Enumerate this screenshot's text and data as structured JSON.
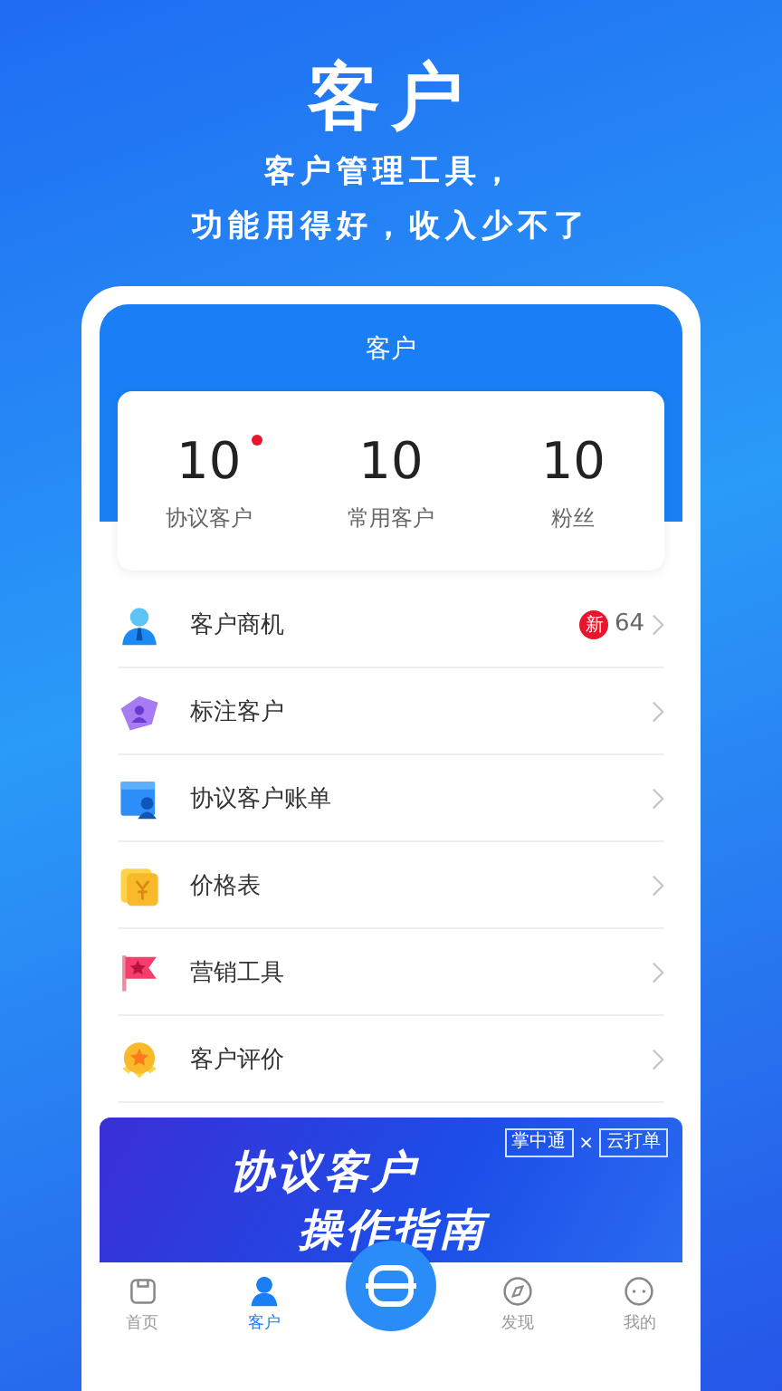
{
  "headline": "客户",
  "tagline": [
    "客户管理工具，",
    "功能用得好，收入少不了"
  ],
  "screen": {
    "title": "客户",
    "stats": [
      {
        "value": "10",
        "label": "协议客户",
        "dot": true
      },
      {
        "value": "10",
        "label": "常用客户",
        "dot": false
      },
      {
        "value": "10",
        "label": "粉丝",
        "dot": false
      }
    ],
    "menu": [
      {
        "label": "客户商机",
        "badge": "新",
        "count": "64"
      },
      {
        "label": "标注客户"
      },
      {
        "label": "协议客户账单"
      },
      {
        "label": "价格表"
      },
      {
        "label": "营销工具"
      },
      {
        "label": "客户评价"
      }
    ],
    "banner": {
      "tags": [
        "掌中通",
        "×",
        "云打单"
      ],
      "lines": [
        "协议客户",
        "操作指南"
      ]
    },
    "nav": [
      {
        "kind": "tab",
        "label": "首页",
        "selected": false
      },
      {
        "kind": "tab",
        "label": "客户",
        "selected": true
      },
      {
        "kind": "scan"
      },
      {
        "kind": "tab",
        "label": "发现",
        "selected": false
      },
      {
        "kind": "tab",
        "label": "我的",
        "selected": false
      }
    ]
  }
}
